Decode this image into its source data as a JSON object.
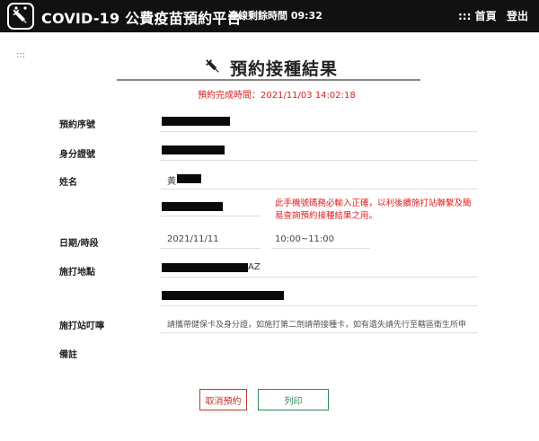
{
  "header": {
    "app_title": "COVID-19 公費疫苗預約平台",
    "session_label": "連線剩餘時間 09:32",
    "home_label": "::: 首頁",
    "logout_label": "登出"
  },
  "side_menu_label": ":::",
  "page": {
    "title": "預約接種結果",
    "completed_time": "預約完成時間：2021/11/03 14:02:18"
  },
  "fields": {
    "booking_no_label": "預約序號",
    "id_no_label": "身分證號",
    "name_label": "姓名",
    "name_prefix": "黃",
    "phone_note": "此手機號碼務必輸入正確，以利後續施打站聯繫及簡易查詢預約接種結果之用。",
    "date_label": "日期/時段",
    "date_value": "2021/11/11",
    "time_value": "10:00~11:00",
    "site_label": "施打地點",
    "site_suffix": "AZ",
    "reminder_label": "施打站叮嚀",
    "reminder_text": "請攜帶健保卡及身分證，如施打第二劑請帶接種卡，如有遺失請先行至轄區衛生所申",
    "note_label": "備註"
  },
  "buttons": {
    "cancel_label": "取消預約",
    "print_label": "列印"
  },
  "colors": {
    "topbar": "#111111",
    "alert_red": "#e02020",
    "cancel_red": "#c0392b",
    "print_green": "#2e8b57"
  }
}
